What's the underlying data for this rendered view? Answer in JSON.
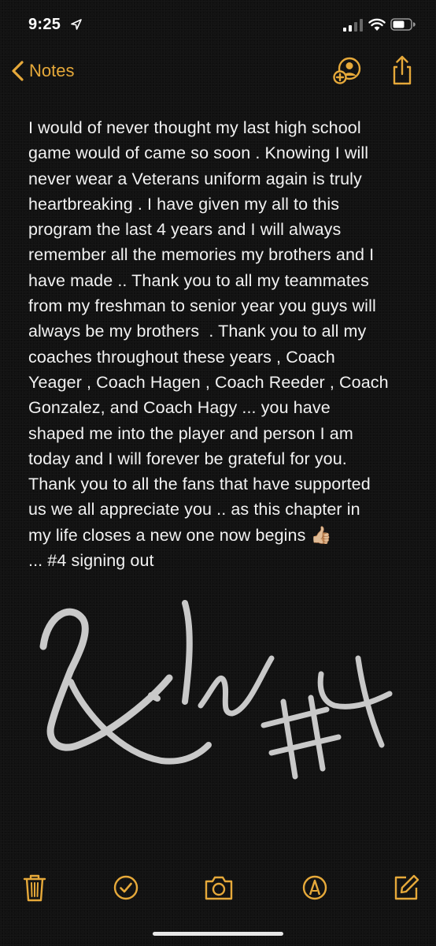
{
  "status_bar": {
    "time": "9:25",
    "location_icon": "location-arrow-icon",
    "signal_icon": "cellular-signal-icon",
    "wifi_icon": "wifi-icon",
    "battery_icon": "battery-icon"
  },
  "nav": {
    "back_label": "Notes",
    "back_icon": "chevron-left-icon",
    "add_person_icon": "add-person-icon",
    "share_icon": "share-icon"
  },
  "note": {
    "text": "I would of never thought my last high school\ngame would of came so soon . Knowing I will\nnever wear a Veterans uniform again is truly\nheartbreaking . I have given my all to this\nprogram the last 4 years and I will always\nremember all the memories my brothers and I\nhave made .. Thank you to all my teammates\nfrom my freshman to senior year you guys will\nalways be my brothers  . Thank you to all my\ncoaches throughout these years , Coach\nYeager , Coach Hagen , Coach Reeder , Coach\nGonzalez, and Coach Hagy ... you have\nshaped me into the player and person I am\ntoday and I will forever be grateful for you.\nThank you to all the fans that have supported\nus we all appreciate you .. as this chapter in\nmy life closes a new one now begins 👍🏼\n... #4 signing out",
    "signature_text": "Kile #4"
  },
  "toolbar": {
    "delete_icon": "trash-icon",
    "checklist_icon": "checklist-icon",
    "camera_icon": "camera-icon",
    "markup_icon": "markup-pen-icon",
    "compose_icon": "compose-icon"
  },
  "colors": {
    "accent": "#e6a93a",
    "background": "#121212",
    "text": "#f2f2f2",
    "ink": "#d9d9d9"
  }
}
